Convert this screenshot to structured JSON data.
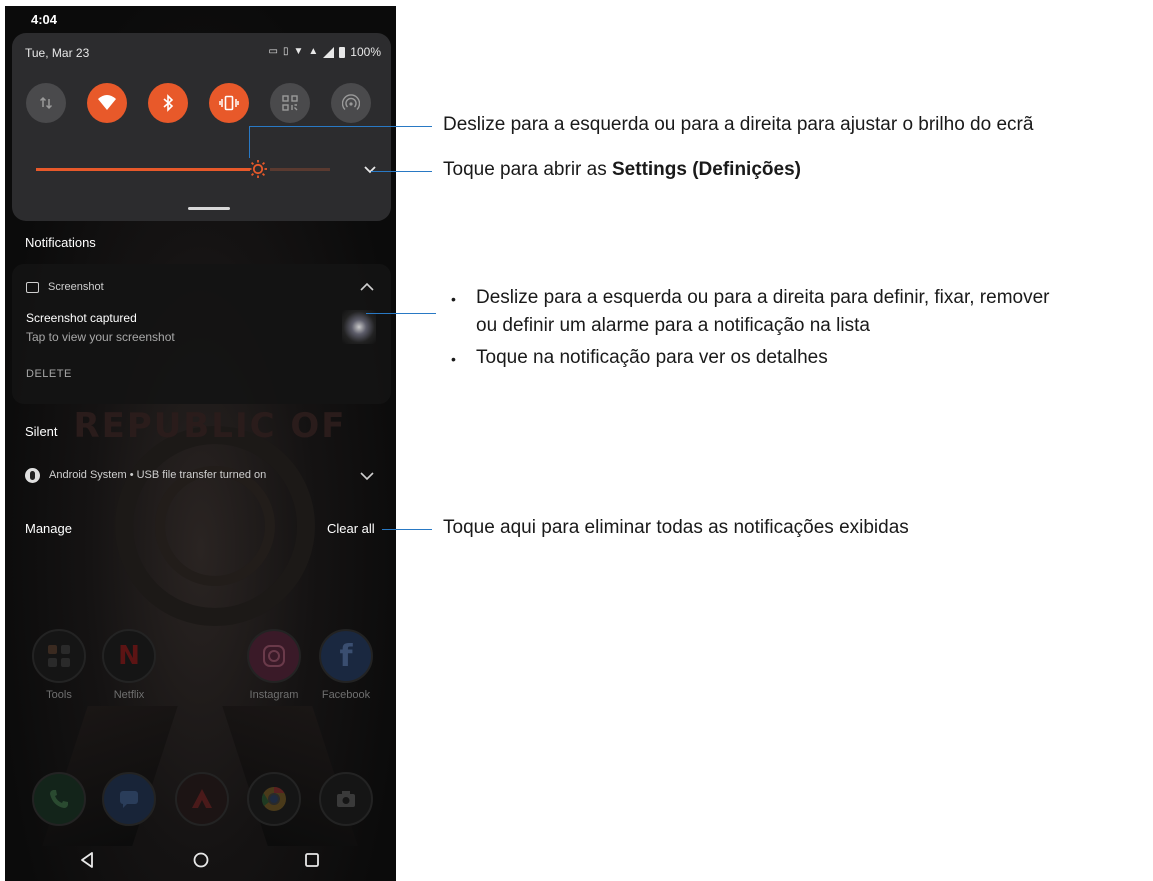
{
  "status_bar": {
    "time": "4:04",
    "date": "Tue, Mar 23",
    "battery": "100%"
  },
  "quick_settings": {
    "tiles": [
      {
        "name": "mobile-data",
        "icon": "arrows-updown-icon",
        "active": false
      },
      {
        "name": "wifi",
        "icon": "wifi-icon",
        "active": true
      },
      {
        "name": "bluetooth",
        "icon": "bluetooth-icon",
        "active": true
      },
      {
        "name": "vibrate",
        "icon": "vibrate-icon",
        "active": true
      },
      {
        "name": "qr-scanner",
        "icon": "qr-code-icon",
        "active": false
      },
      {
        "name": "hotspot",
        "icon": "hotspot-icon",
        "active": false
      }
    ],
    "accent_color": "#e8592a"
  },
  "notifications": {
    "section_title": "Notifications",
    "screenshot": {
      "app": "Screenshot",
      "title": "Screenshot captured",
      "text": "Tap to view your screenshot",
      "action": "DELETE"
    },
    "silent_title": "Silent",
    "silent_item": "Android System • USB file transfer turned on",
    "manage": "Manage",
    "clear_all": "Clear all"
  },
  "home": {
    "row1": [
      "Tools",
      "Netflix",
      "Instagram",
      "Facebook"
    ],
    "wallpaper_text": "REPUBLIC OF"
  },
  "annotations": {
    "brightness": "Deslize para a esquerda ou para a direita para ajustar o brilho do ecrã",
    "settings_prefix": "Toque para abrir as ",
    "settings_bold": "Settings (Definições)",
    "notif_line1": "Deslize para a esquerda ou para a direita para definir, fixar, remover",
    "notif_line2": "ou definir um alarme para a notificação na lista",
    "notif_line3": "Toque na notificação para ver os detalhes",
    "clear_all": "Toque aqui para eliminar todas as notificações exibidas",
    "bullet": "•",
    "line_color": "#2979c4"
  }
}
